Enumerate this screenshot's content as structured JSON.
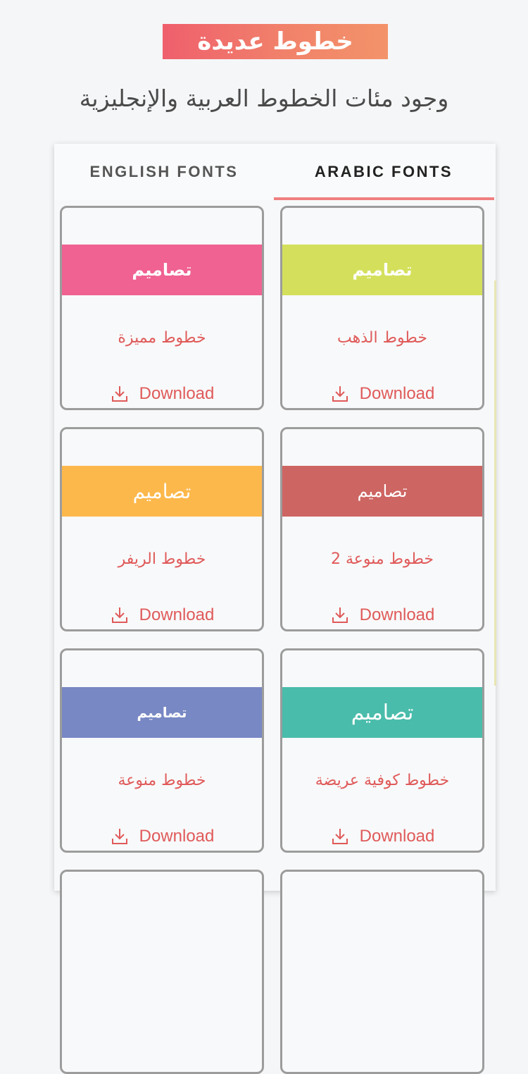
{
  "header": {
    "banner_text": "خطوط عديدة",
    "subtitle": "وجود مئات الخطوط العربية والإنجليزية"
  },
  "tabs": [
    {
      "label": "ENGLISH FONTS",
      "selected": false
    },
    {
      "label": "ARABIC FONTS",
      "selected": true
    }
  ],
  "colors": {
    "accent": "#ef7f80",
    "link": "#e05a5a"
  },
  "cards": [
    {
      "sample": "تصاميم",
      "name": "خطوط الذهب",
      "download_label": "Download",
      "color": "#d4e05c",
      "icon": "download-icon"
    },
    {
      "sample": "تصاميم",
      "name": "خطوط مميزة",
      "download_label": "Download",
      "color": "#f06292",
      "icon": "download-icon"
    },
    {
      "sample": "تصاميم",
      "name": "خطوط منوعة 2",
      "download_label": "Download",
      "color": "#cd6562",
      "icon": "download-icon"
    },
    {
      "sample": "تصاميم",
      "name": "خطوط الريفر",
      "download_label": "Download",
      "color": "#fdb84c",
      "icon": "download-icon"
    },
    {
      "sample": "تصاميم",
      "name": "خطوط كوفية عريضة",
      "download_label": "Download",
      "color": "#4abcab",
      "icon": "download-icon"
    },
    {
      "sample": "تصاميم",
      "name": "خطوط منوعة",
      "download_label": "Download",
      "color": "#7888c4",
      "icon": "download-icon"
    }
  ]
}
